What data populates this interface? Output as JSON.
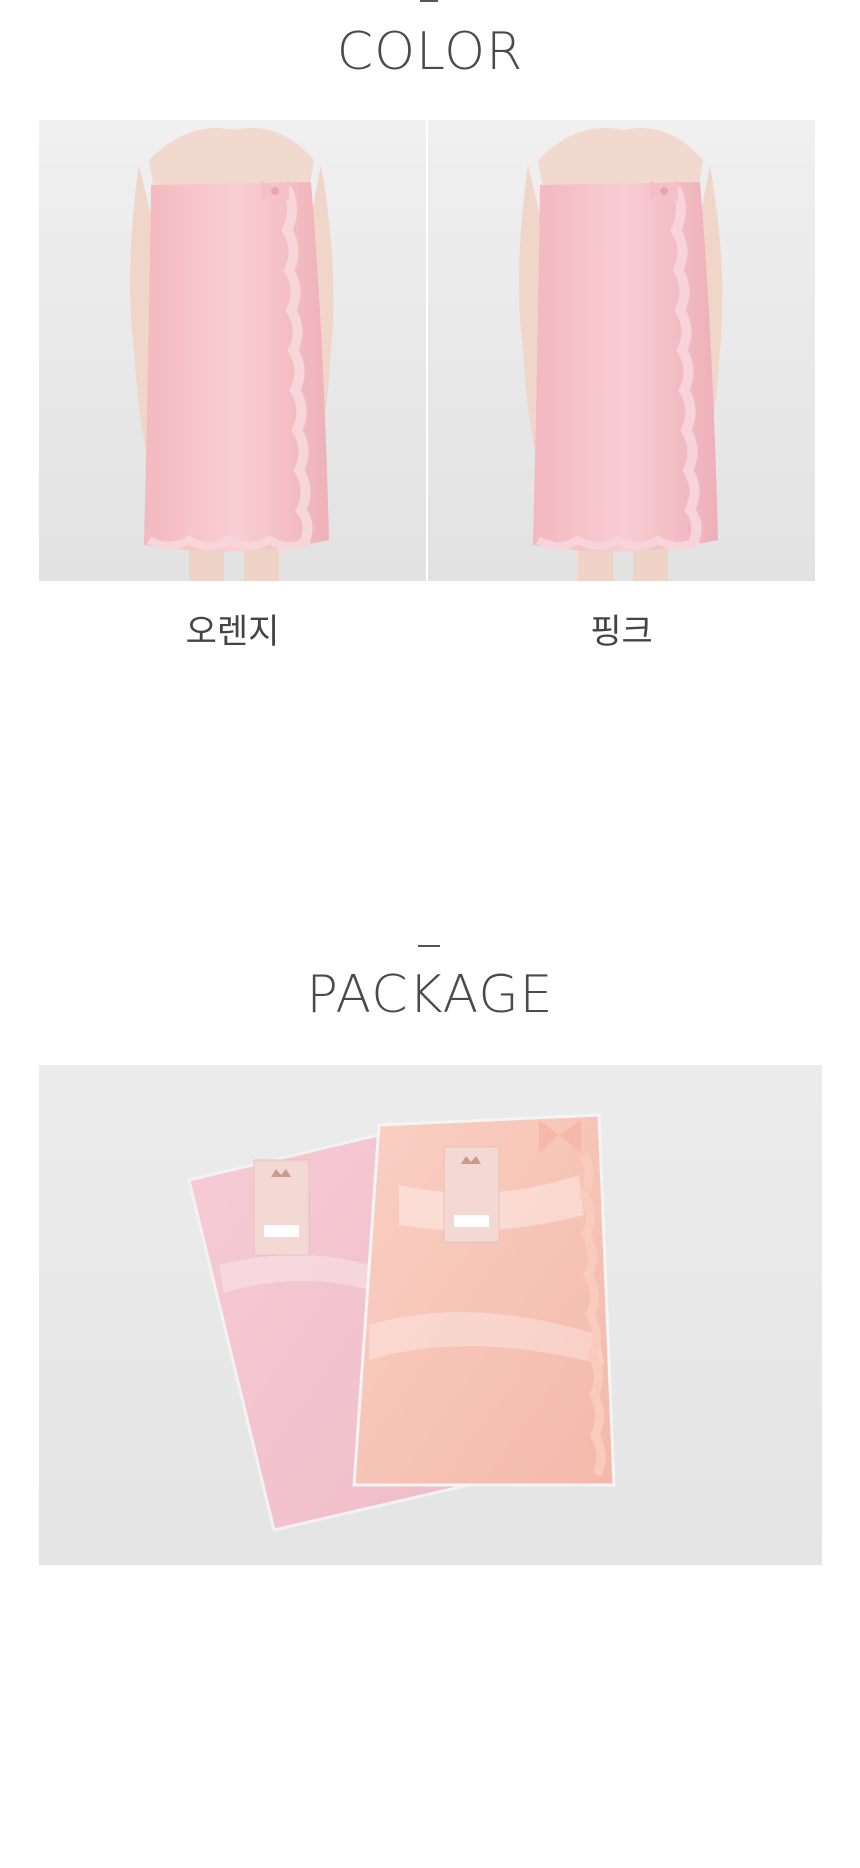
{
  "color_section": {
    "title": "COLOR",
    "options": [
      {
        "label": "오렌지",
        "swatch": "#f6c3c6"
      },
      {
        "label": "핑크",
        "swatch": "#f6c1c5"
      }
    ]
  },
  "package_section": {
    "title": "PACKAGE",
    "package_colors": [
      "#f4c6cf",
      "#f7c2b8"
    ]
  }
}
